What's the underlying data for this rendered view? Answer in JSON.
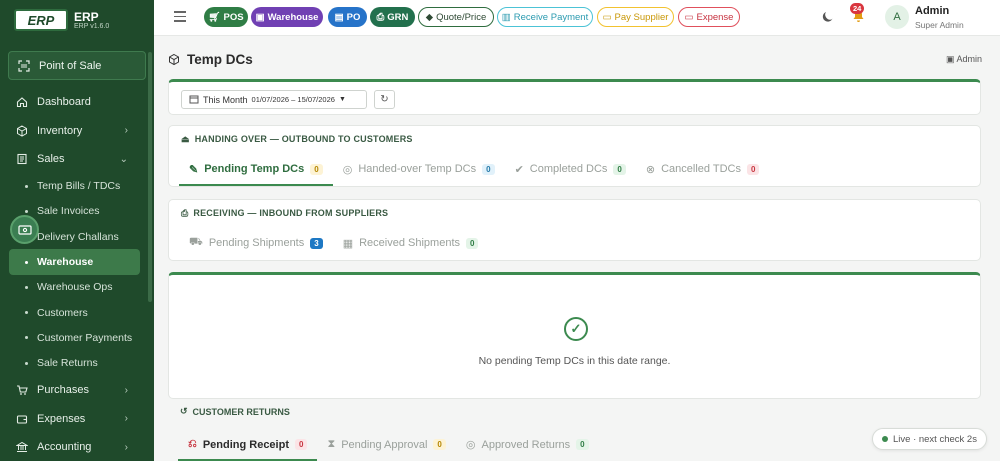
{
  "brand": {
    "logo": "ERP",
    "name": "ERP",
    "version": "ERP v1.6.0"
  },
  "sidebar": {
    "pos_label": "Point of Sale",
    "items": [
      {
        "label": "Dashboard",
        "icon": "house-icon"
      },
      {
        "label": "Inventory",
        "icon": "box-icon",
        "chevron": "›"
      },
      {
        "label": "Sales",
        "icon": "receipt-icon",
        "chevron": "⌄"
      }
    ],
    "sales_sub": [
      "Temp Bills / TDCs",
      "Sale Invoices",
      "Delivery Challans",
      "Warehouse",
      "Warehouse Ops",
      "Customers",
      "Customer Payments",
      "Sale Returns"
    ],
    "bottom_items": [
      {
        "label": "Purchases",
        "chevron": "›"
      },
      {
        "label": "Expenses",
        "chevron": "›"
      },
      {
        "label": "Accounting",
        "chevron": "›"
      }
    ]
  },
  "topbar": {
    "quick_buttons": [
      "POS",
      "Warehouse",
      "PO",
      "GRN",
      "Quote/Price",
      "Receive Payment",
      "Pay Supplier",
      "Expense"
    ],
    "notification_count": "24",
    "avatar_initial": "A",
    "user_name": "Admin",
    "user_role": "Super Admin"
  },
  "page": {
    "title": "Temp DCs",
    "crumb": "Admin",
    "filter": {
      "preset": "This Month",
      "range": "01/07/2026 – 15/07/2026"
    }
  },
  "handing_over": {
    "heading": "HANDING OVER — OUTBOUND TO CUSTOMERS",
    "tabs": [
      {
        "label": "Pending Temp DCs",
        "count": "0"
      },
      {
        "label": "Handed-over Temp DCs",
        "count": "0"
      },
      {
        "label": "Completed DCs",
        "count": "0"
      },
      {
        "label": "Cancelled TDCs",
        "count": "0"
      }
    ]
  },
  "receiving": {
    "heading": "RECEIVING — INBOUND FROM SUPPLIERS",
    "tabs": [
      {
        "label": "Pending Shipments",
        "count": "3"
      },
      {
        "label": "Received Shipments",
        "count": "0"
      }
    ]
  },
  "empty_state": {
    "message": "No pending Temp DCs in this date range."
  },
  "customer_returns": {
    "heading": "CUSTOMER RETURNS",
    "tabs": [
      {
        "label": "Pending Receipt",
        "count": "0"
      },
      {
        "label": "Pending Approval",
        "count": "0"
      },
      {
        "label": "Approved Returns",
        "count": "0"
      }
    ]
  },
  "live_status": "Live · next check 2s"
}
